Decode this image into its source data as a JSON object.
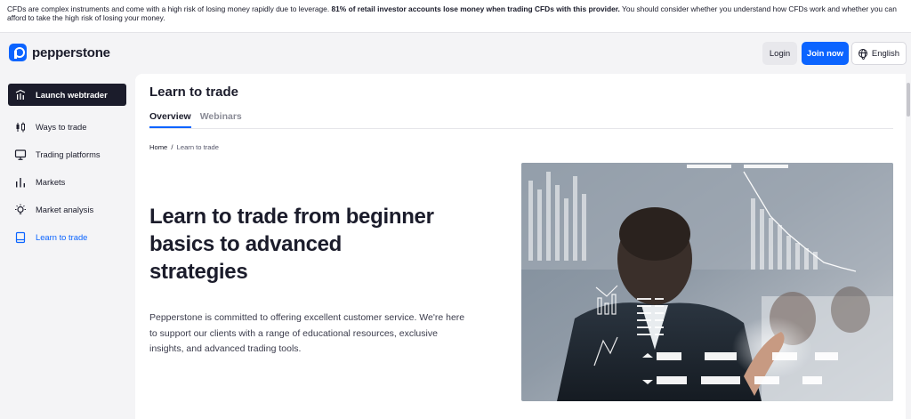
{
  "risk_banner": {
    "text_start": "CFDs are complex instruments and come with a high risk of losing money rapidly due to leverage. ",
    "text_bold": "81% of retail investor accounts lose money when trading CFDs with this provider.",
    "text_end": " You should consider whether you understand how CFDs work and whether you can afford to take the high risk of losing your money."
  },
  "header": {
    "logo_text": "pepperstone",
    "login_label": "Login",
    "join_label": "Join now",
    "language_label": "English",
    "brand_color": "#0b64ff"
  },
  "sidebar": {
    "items": [
      {
        "label": "Launch webtrader",
        "icon": "webtrader-icon"
      },
      {
        "label": "Ways to trade",
        "icon": "candlestick-icon"
      },
      {
        "label": "Trading platforms",
        "icon": "monitor-icon"
      },
      {
        "label": "Markets",
        "icon": "bar-chart-icon"
      },
      {
        "label": "Market analysis",
        "icon": "lightbulb-icon"
      },
      {
        "label": "Learn to trade",
        "icon": "book-icon"
      }
    ]
  },
  "main": {
    "page_title": "Learn to trade",
    "tabs": [
      {
        "label": "Overview"
      },
      {
        "label": "Webinars"
      }
    ],
    "breadcrumb": {
      "home": "Home",
      "separator": "/",
      "current": "Learn to trade"
    },
    "hero": {
      "title": "Learn to trade from beginner basics to advanced strategies",
      "body": "Pepperstone is committed to offering excellent customer service. We're here to support our clients with a range of educational resources, exclusive insights, and advanced trading tools."
    }
  }
}
